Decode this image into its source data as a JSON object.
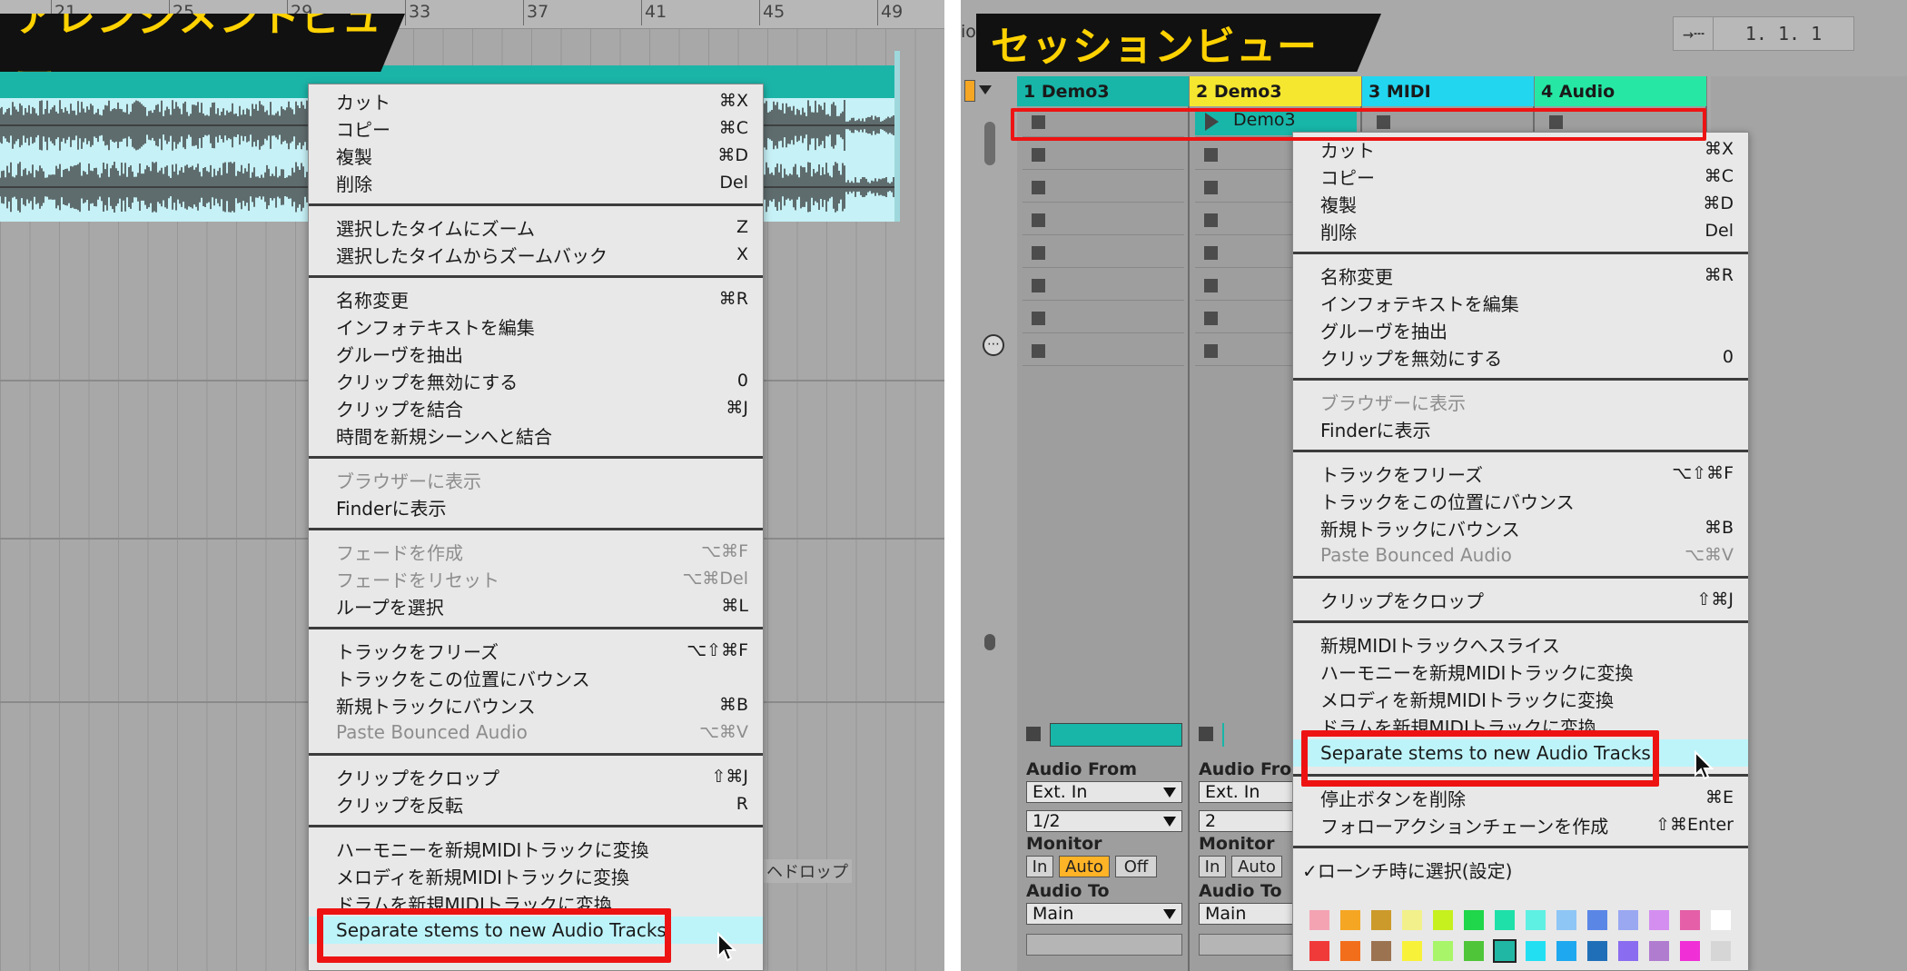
{
  "arrangement": {
    "banner": "アレンジメントビュー",
    "ruler_numbers": [
      "21",
      "25",
      "29",
      "33",
      "37",
      "41",
      "45",
      "49"
    ],
    "drop_hint": "ヘドロップ",
    "menu": {
      "groups": [
        [
          {
            "label": "カット",
            "shortcut": "⌘X"
          },
          {
            "label": "コピー",
            "shortcut": "⌘C"
          },
          {
            "label": "複製",
            "shortcut": "⌘D"
          },
          {
            "label": "削除",
            "shortcut": "Del"
          }
        ],
        [
          {
            "label": "選択したタイムにズーム",
            "shortcut": "Z"
          },
          {
            "label": "選択したタイムからズームバック",
            "shortcut": "X"
          }
        ],
        [
          {
            "label": "名称変更",
            "shortcut": "⌘R"
          },
          {
            "label": "インフォテキストを編集",
            "shortcut": ""
          },
          {
            "label": "グルーヴを抽出",
            "shortcut": ""
          },
          {
            "label": "クリップを無効にする",
            "shortcut": "0"
          },
          {
            "label": "クリップを結合",
            "shortcut": "⌘J"
          },
          {
            "label": "時間を新規シーンへと結合",
            "shortcut": ""
          }
        ],
        [
          {
            "label": "ブラウザーに表示",
            "shortcut": "",
            "disabled": true
          },
          {
            "label": "Finderに表示",
            "shortcut": ""
          }
        ],
        [
          {
            "label": "フェードを作成",
            "shortcut": "⌥⌘F",
            "disabled": true
          },
          {
            "label": "フェードをリセット",
            "shortcut": "⌥⌘Del",
            "disabled": true
          },
          {
            "label": "ループを選択",
            "shortcut": "⌘L"
          }
        ],
        [
          {
            "label": "トラックをフリーズ",
            "shortcut": "⌥⇧⌘F"
          },
          {
            "label": "トラックをこの位置にバウンス",
            "shortcut": ""
          },
          {
            "label": "新規トラックにバウンス",
            "shortcut": "⌘B"
          },
          {
            "label": "Paste Bounced Audio",
            "shortcut": "⌥⌘V",
            "disabled": true
          }
        ],
        [
          {
            "label": "クリップをクロップ",
            "shortcut": "⇧⌘J"
          },
          {
            "label": "クリップを反転",
            "shortcut": "R"
          }
        ],
        [
          {
            "label": "ハーモニーを新規MIDIトラックに変換",
            "shortcut": ""
          },
          {
            "label": "メロディを新規MIDIトラックに変換",
            "shortcut": ""
          },
          {
            "label": "ドラムを新規MIDIトラックに変換",
            "shortcut": ""
          },
          {
            "label": "Separate stems to new Audio Tracks",
            "shortcut": "",
            "highlight": true
          }
        ]
      ]
    }
  },
  "session": {
    "banner": "セッションビュー",
    "partial_label": "ion",
    "position_display": "1.  1.  1",
    "tracks": [
      {
        "name": "1 Demo3",
        "color": "#17b6a8"
      },
      {
        "name": "2 Demo3",
        "color": "#f5e72f"
      },
      {
        "name": "3 MIDI",
        "color": "#22d6f0"
      },
      {
        "name": "4 Audio",
        "color": "#26e8a4"
      }
    ],
    "clip_name": "Demo3",
    "io": {
      "audio_from_label": "Audio From",
      "audio_from_partial": "Audio Fror",
      "source_1": "Ext. In",
      "channel_1": "1/2",
      "channel_2": "2",
      "monitor_label": "Monitor",
      "mon_in": "In",
      "mon_auto": "Auto",
      "mon_off": "Off",
      "audio_to_label": "Audio To",
      "dest": "Main"
    },
    "menu": {
      "groups": [
        [
          {
            "label": "カット",
            "shortcut": "⌘X"
          },
          {
            "label": "コピー",
            "shortcut": "⌘C"
          },
          {
            "label": "複製",
            "shortcut": "⌘D"
          },
          {
            "label": "削除",
            "shortcut": "Del"
          }
        ],
        [
          {
            "label": "名称変更",
            "shortcut": "⌘R"
          },
          {
            "label": "インフォテキストを編集",
            "shortcut": ""
          },
          {
            "label": "グルーヴを抽出",
            "shortcut": ""
          },
          {
            "label": "クリップを無効にする",
            "shortcut": "0"
          }
        ],
        [
          {
            "label": "ブラウザーに表示",
            "shortcut": "",
            "disabled": true
          },
          {
            "label": "Finderに表示",
            "shortcut": ""
          }
        ],
        [
          {
            "label": "トラックをフリーズ",
            "shortcut": "⌥⇧⌘F"
          },
          {
            "label": "トラックをこの位置にバウンス",
            "shortcut": ""
          },
          {
            "label": "新規トラックにバウンス",
            "shortcut": "⌘B"
          },
          {
            "label": "Paste Bounced Audio",
            "shortcut": "⌥⌘V",
            "disabled": true
          }
        ],
        [
          {
            "label": "クリップをクロップ",
            "shortcut": "⇧⌘J"
          }
        ],
        [
          {
            "label": "新規MIDIトラックへスライス",
            "shortcut": ""
          },
          {
            "label": "ハーモニーを新規MIDIトラックに変換",
            "shortcut": ""
          },
          {
            "label": "メロディを新規MIDIトラックに変換",
            "shortcut": ""
          },
          {
            "label": "ドラムを新規MIDIトラックに変換",
            "shortcut": ""
          },
          {
            "label": "Separate stems to new Audio Tracks",
            "shortcut": "",
            "highlight": true
          }
        ],
        [
          {
            "label": "停止ボタンを削除",
            "shortcut": "⌘E"
          },
          {
            "label": "フォローアクションチェーンを作成",
            "shortcut": "⇧⌘Enter"
          }
        ],
        [
          {
            "label": "ローンチ時に選択(設定)",
            "shortcut": "",
            "checked": true
          }
        ]
      ],
      "palette_row1": [
        "#f4a3b3",
        "#f5a623",
        "#cc9a2b",
        "#f2f08a",
        "#c6f01e",
        "#20d64a",
        "#1ee0a8",
        "#5ef0e2",
        "#8ec6f6",
        "#5a86e6",
        "#9aa8f2",
        "#d48ef0",
        "#e45fa8",
        "#ffffff"
      ],
      "palette_row2": [
        "#f03a3a",
        "#f26e1b",
        "#9c7351",
        "#f7f13a",
        "#a8f56a",
        "#4fc63a",
        "#20b8a4",
        "#22e0f2",
        "#1ea8ef",
        "#1f6fb8",
        "#8a6cf0",
        "#b07cd0",
        "#f02fd6",
        "#d6d6d6"
      ]
    }
  }
}
